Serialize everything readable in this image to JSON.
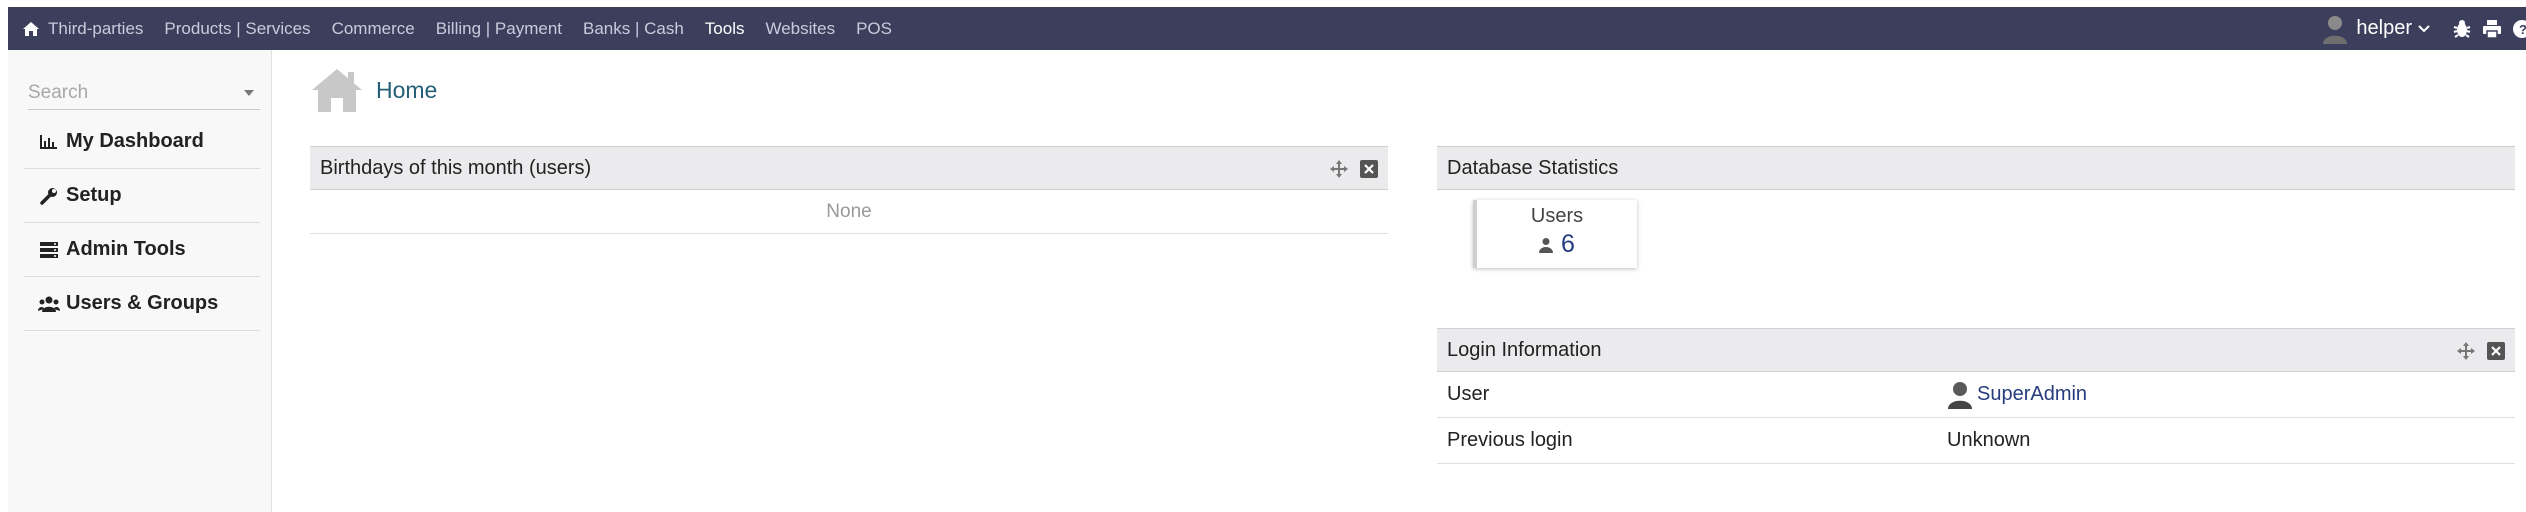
{
  "topbar": {
    "home_icon": "home-icon",
    "menu": [
      "Third-parties",
      "Products | Services",
      "Commerce",
      "Billing | Payment",
      "Banks | Cash",
      "Tools",
      "Websites",
      "POS"
    ],
    "active": "Tools",
    "user": "helper",
    "colors": {
      "bar": "#3c3f5c",
      "text": "#c9cbdc",
      "active_text": "#ffffff"
    }
  },
  "sidebar": {
    "search_placeholder": "Search",
    "items": [
      {
        "label": "My Dashboard",
        "icon": "bar-chart-icon"
      },
      {
        "label": "Setup",
        "icon": "wrench-icon"
      },
      {
        "label": "Admin Tools",
        "icon": "server-icon"
      },
      {
        "label": "Users & Groups",
        "icon": "users-icon"
      }
    ]
  },
  "page": {
    "title": "Home"
  },
  "birthdays": {
    "title": "Birthdays of this month (users)",
    "empty_text": "None"
  },
  "db_stats": {
    "title": "Database Statistics",
    "users_label": "Users",
    "users_count": "6"
  },
  "login_info": {
    "title": "Login Information",
    "rows": [
      {
        "label": "User",
        "value": "SuperAdmin"
      },
      {
        "label": "Previous login",
        "value": "Unknown"
      }
    ]
  },
  "colors": {
    "link": "#263c7e",
    "title": "#245f77",
    "box_header": "#ebebed"
  }
}
